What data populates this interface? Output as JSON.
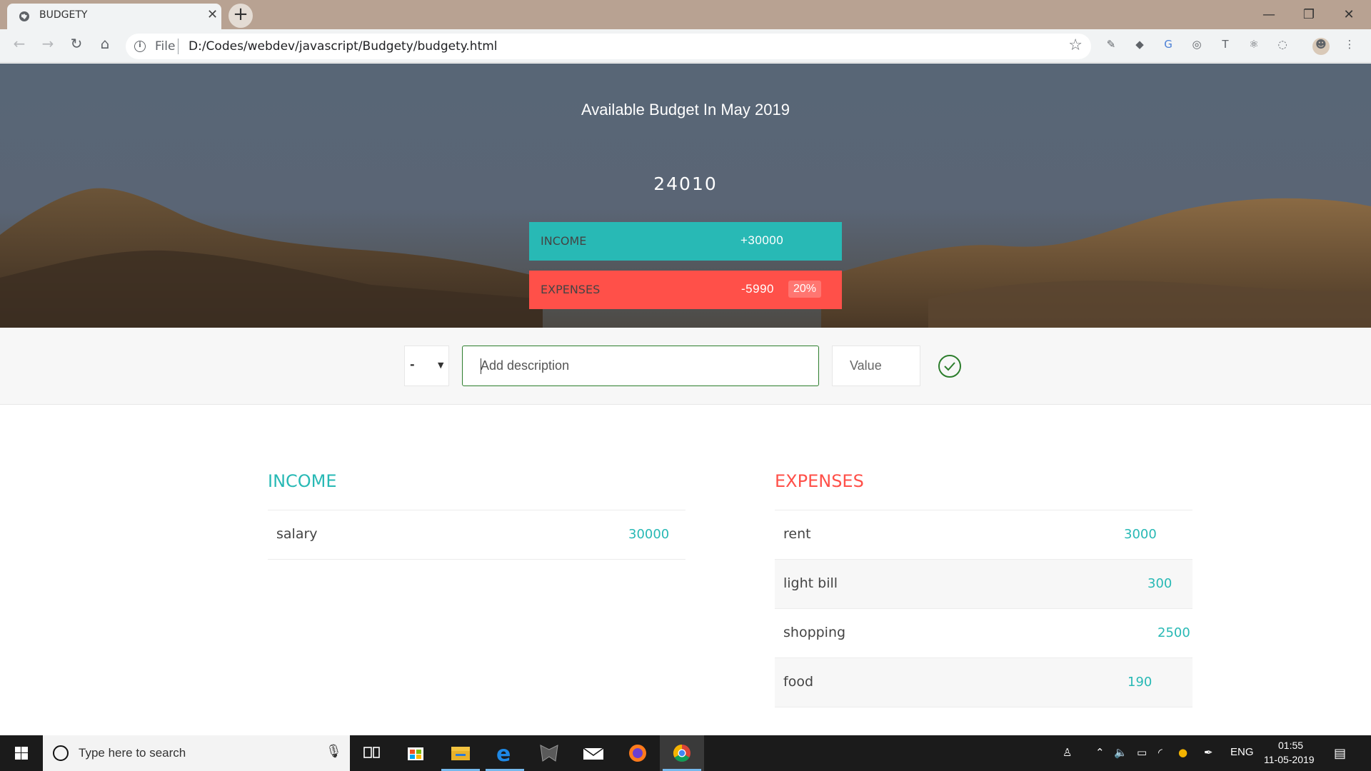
{
  "browser": {
    "tab_title": "BUDGETY",
    "tab_close": "✕",
    "new_tab": "+",
    "url_scheme": "File",
    "url": "D:/Codes/webdev/javascript/Budgety/budgety.html",
    "window_controls": {
      "minimize": "—",
      "maximize": "❐",
      "close": "✕"
    }
  },
  "header": {
    "title": "Available Budget In May 2019",
    "budget": "24010",
    "income_label": "INCOME",
    "income_value": "+30000",
    "expenses_label": "EXPENSES",
    "expenses_value": "-5990",
    "expenses_percentage": "20%"
  },
  "add_form": {
    "type_selected": "-",
    "description_placeholder": "Add description",
    "value_placeholder": "Value"
  },
  "income": {
    "title": "INCOME",
    "items": [
      {
        "description": "salary",
        "value": "30000"
      }
    ]
  },
  "expenses": {
    "title": "EXPENSES",
    "items": [
      {
        "description": "rent",
        "value": "3000"
      },
      {
        "description": "light bill",
        "value": "300"
      },
      {
        "description": "shopping",
        "value": "2500"
      },
      {
        "description": "food",
        "value": "190"
      }
    ]
  },
  "taskbar": {
    "search_placeholder": "Type here to search",
    "language": "ENG",
    "time": "01:55",
    "date": "11-05-2019"
  },
  "colors": {
    "income": "#28b9b5",
    "expenses": "#ff5049",
    "add_border": "#2c7d2c"
  }
}
